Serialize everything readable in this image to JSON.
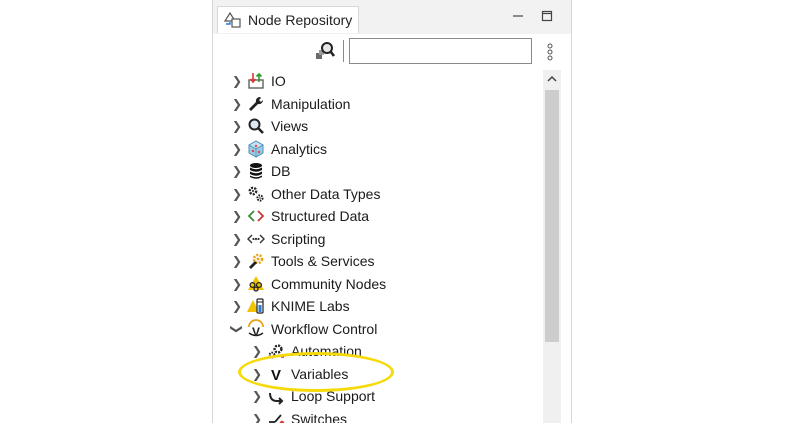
{
  "panel": {
    "title": "Node Repository",
    "minimize_icon": "minimize-icon",
    "maximize_icon": "maximize-icon"
  },
  "search": {
    "value": "",
    "placeholder": "",
    "filter_icon": "search-filter-icon",
    "menu_icon": "vertical-dots-icon"
  },
  "tree": {
    "items": [
      {
        "label": "IO",
        "icon": "io-icon",
        "expanded": false
      },
      {
        "label": "Manipulation",
        "icon": "wrench-icon",
        "expanded": false
      },
      {
        "label": "Views",
        "icon": "magnifier-icon",
        "expanded": false
      },
      {
        "label": "Analytics",
        "icon": "cube-icon",
        "expanded": false
      },
      {
        "label": "DB",
        "icon": "database-icon",
        "expanded": false
      },
      {
        "label": "Other Data Types",
        "icon": "gears-icon",
        "expanded": false
      },
      {
        "label": "Structured Data",
        "icon": "code-brackets-icon",
        "expanded": false
      },
      {
        "label": "Scripting",
        "icon": "script-icon",
        "expanded": false
      },
      {
        "label": "Tools & Services",
        "icon": "tools-icon",
        "expanded": false
      },
      {
        "label": "Community Nodes",
        "icon": "community-icon",
        "expanded": false
      },
      {
        "label": "KNIME Labs",
        "icon": "labs-icon",
        "expanded": false
      },
      {
        "label": "Workflow Control",
        "icon": "workflow-icon",
        "expanded": true
      }
    ],
    "children": [
      {
        "label": "Automation",
        "icon": "automation-icon"
      },
      {
        "label": "Variables",
        "icon": "variable-v-icon"
      },
      {
        "label": "Loop Support",
        "icon": "loop-icon"
      },
      {
        "label": "Switches",
        "icon": "switch-icon"
      }
    ]
  },
  "colors": {
    "highlight": "#f5d90a",
    "header_bg": "#f2f2f2",
    "scroll_thumb": "#cdcdcd"
  }
}
